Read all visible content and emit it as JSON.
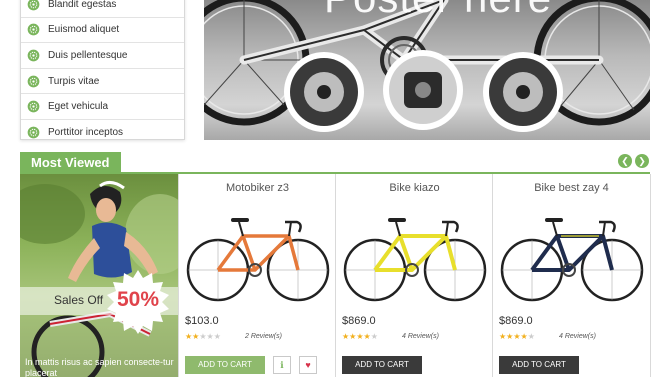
{
  "sidebar": {
    "items": [
      {
        "label": "Blandit egestas"
      },
      {
        "label": "Euismod aliquet"
      },
      {
        "label": "Duis pellentesque"
      },
      {
        "label": "Turpis vitae"
      },
      {
        "label": "Eget vehicula"
      },
      {
        "label": "Porttitor inceptos"
      }
    ],
    "icon": "gear-icon",
    "icon_color": "#7ab55c"
  },
  "banner": {
    "title": "Poster here"
  },
  "section": {
    "title": "Most Viewed",
    "prev_icon": "chevron-left-icon",
    "next_icon": "chevron-right-icon",
    "accent": "#7ab55c"
  },
  "promo": {
    "sale_label": "Sales Off",
    "percent": "50%",
    "caption": "In mattis risus ac sapien consecte-tur placerat"
  },
  "products": [
    {
      "name": "Motobiker z3",
      "price": "$103.0",
      "rating": 2,
      "reviews": "2 Review(s)",
      "cart_label": "ADD TO CART",
      "cart_style": "green",
      "frame_color": "#e5793a",
      "has_extra_buttons": true
    },
    {
      "name": "Bike kiazo",
      "price": "$869.0",
      "rating": 4,
      "reviews": "4 Review(s)",
      "cart_label": "ADD TO CART",
      "cart_style": "dark",
      "frame_color": "#e8df2c",
      "has_extra_buttons": false
    },
    {
      "name": "Bike best zay 4",
      "price": "$869.0",
      "rating": 4,
      "reviews": "4 Review(s)",
      "cart_label": "ADD TO CART",
      "cart_style": "dark",
      "frame_color": "#1f2c4d",
      "has_extra_buttons": false
    }
  ],
  "extra_buttons": {
    "info_icon": "info-icon",
    "info_glyph": "ℹ",
    "wishlist_icon": "heart-icon",
    "wishlist_glyph": "♥"
  }
}
